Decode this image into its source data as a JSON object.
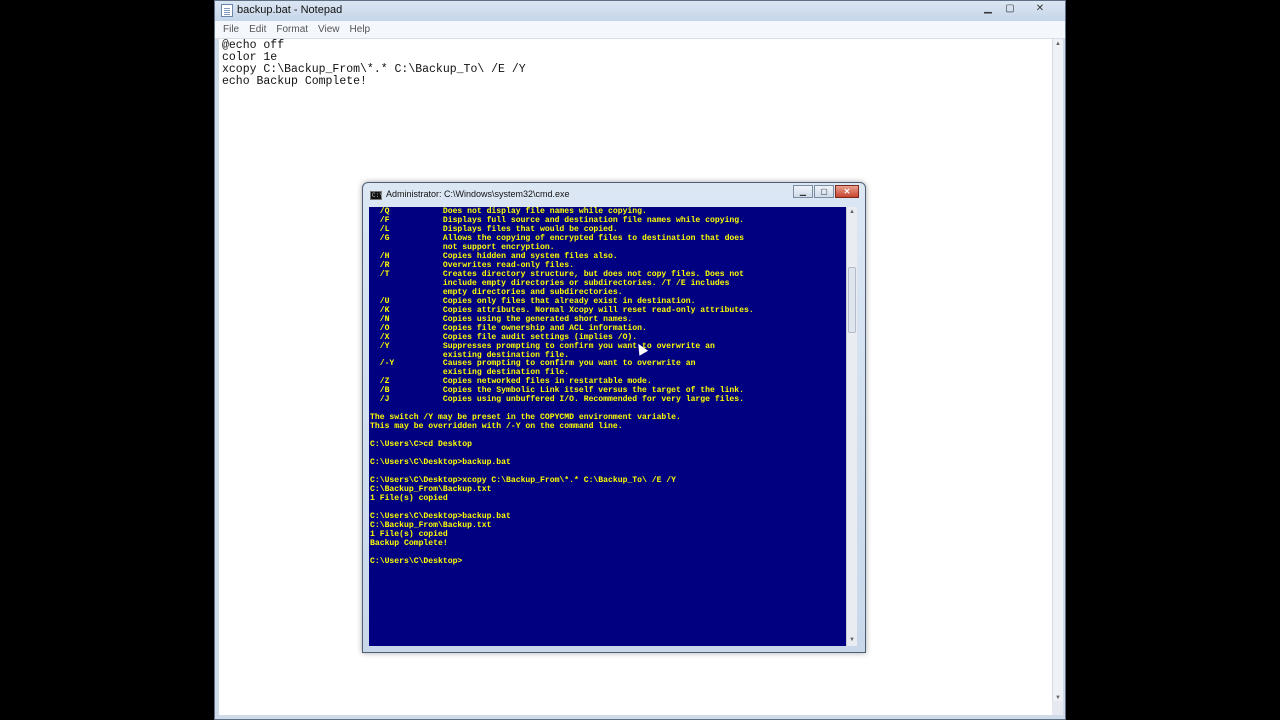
{
  "notepad": {
    "title": "backup.bat - Notepad",
    "menu": [
      {
        "key": "F",
        "rest": "ile"
      },
      {
        "key": "E",
        "rest": "dit"
      },
      {
        "key": "",
        "rest": "F",
        "key2": "o",
        "rest2": "rmat"
      },
      {
        "key": "V",
        "rest": "iew"
      },
      {
        "key": "H",
        "rest": "elp"
      }
    ],
    "menu_labels": [
      "File",
      "Edit",
      "Format",
      "View",
      "Help"
    ],
    "content": "@echo off\ncolor 1e\nxcopy C:\\Backup_From\\*.* C:\\Backup_To\\ /E /Y\necho Backup Complete!",
    "minimize_glyph": "▁",
    "maximize_glyph": "▢",
    "close_glyph": "✕"
  },
  "cmd": {
    "title": "Administrator: C:\\Windows\\system32\\cmd.exe",
    "icon_text": "C:\\",
    "background_color": "#000080",
    "text_color": "#ffff00",
    "minimize_glyph": "▁",
    "maximize_glyph": "▢",
    "close_glyph": "✕",
    "output": "  /Q           Does not display file names while copying.\n  /F           Displays full source and destination file names while copying.\n  /L           Displays files that would be copied.\n  /G           Allows the copying of encrypted files to destination that does\n               not support encryption.\n  /H           Copies hidden and system files also.\n  /R           Overwrites read-only files.\n  /T           Creates directory structure, but does not copy files. Does not\n               include empty directories or subdirectories. /T /E includes\n               empty directories and subdirectories.\n  /U           Copies only files that already exist in destination.\n  /K           Copies attributes. Normal Xcopy will reset read-only attributes.\n  /N           Copies using the generated short names.\n  /O           Copies file ownership and ACL information.\n  /X           Copies file audit settings (implies /O).\n  /Y           Suppresses prompting to confirm you want to overwrite an\n               existing destination file.\n  /-Y          Causes prompting to confirm you want to overwrite an\n               existing destination file.\n  /Z           Copies networked files in restartable mode.\n  /B           Copies the Symbolic Link itself versus the target of the link.\n  /J           Copies using unbuffered I/O. Recommended for very large files.\n\nThe switch /Y may be preset in the COPYCMD environment variable.\nThis may be overridden with /-Y on the command line.\n\nC:\\Users\\C>cd Desktop\n\nC:\\Users\\C\\Desktop>backup.bat\n\nC:\\Users\\C\\Desktop>xcopy C:\\Backup_From\\*.* C:\\Backup_To\\ /E /Y\nC:\\Backup_From\\Backup.txt\n1 File(s) copied\n\nC:\\Users\\C\\Desktop>backup.bat\nC:\\Backup_From\\Backup.txt\n1 File(s) copied\nBackup Complete!\n\nC:\\Users\\C\\Desktop>"
  },
  "scroll": {
    "up_glyph": "▲",
    "down_glyph": "▼"
  }
}
